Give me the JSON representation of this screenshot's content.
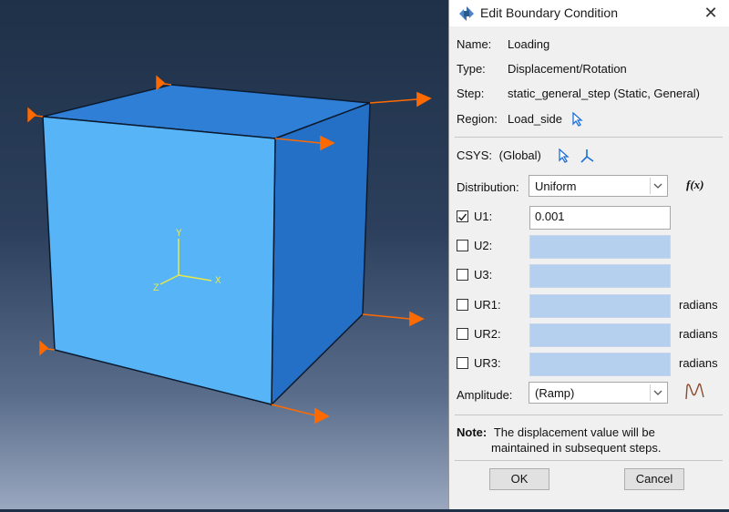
{
  "viewport": {
    "triad": {
      "x": "X",
      "y": "Y",
      "z": "Z"
    }
  },
  "dialog": {
    "title": "Edit Boundary Condition",
    "close_glyph": "✕",
    "name_label": "Name:",
    "name_value": "Loading",
    "type_label": "Type:",
    "type_value": "Displacement/Rotation",
    "step_label": "Step:",
    "step_value": "static_general_step (Static, General)",
    "region_label": "Region:",
    "region_value": "Load_side",
    "csys_label": "CSYS:",
    "csys_value": "(Global)",
    "distribution_label": "Distribution:",
    "distribution_value": "Uniform",
    "fx_label": "f(x)",
    "dofs": [
      {
        "label": "U1:",
        "checked": true,
        "value": "0.001",
        "unit": ""
      },
      {
        "label": "U2:",
        "checked": false,
        "value": "",
        "unit": ""
      },
      {
        "label": "U3:",
        "checked": false,
        "value": "",
        "unit": ""
      },
      {
        "label": "UR1:",
        "checked": false,
        "value": "",
        "unit": "radians"
      },
      {
        "label": "UR2:",
        "checked": false,
        "value": "",
        "unit": "radians"
      },
      {
        "label": "UR3:",
        "checked": false,
        "value": "",
        "unit": "radians"
      }
    ],
    "amplitude_label": "Amplitude:",
    "amplitude_value": "(Ramp)",
    "note_label": "Note:",
    "note_line1": "The displacement value will be",
    "note_line2": "maintained in subsequent steps.",
    "ok_label": "OK",
    "cancel_label": "Cancel",
    "colors": {
      "dialog_bg": "#f0f0f0",
      "disabled_field": "#b5d0ee",
      "cube_front": "#56b4f7",
      "cube_side": "#2470c6",
      "cube_top": "#2f7fd6",
      "bc_arrow": "#ff6a00",
      "triad": "#e8e84a"
    }
  }
}
